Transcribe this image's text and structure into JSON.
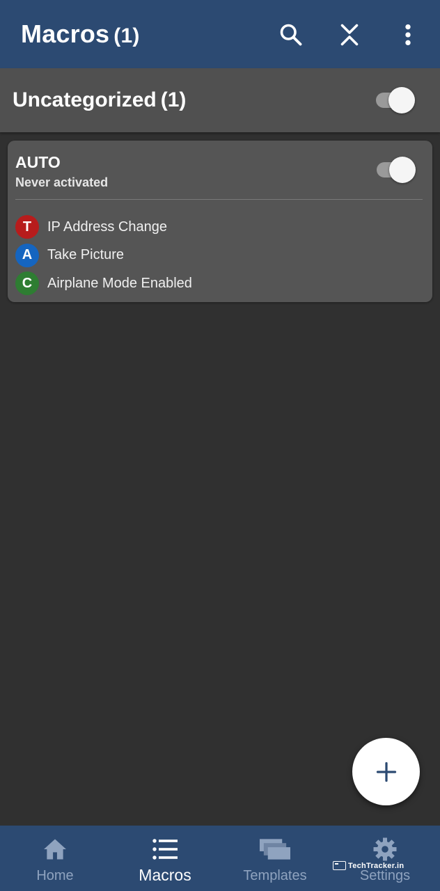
{
  "appbar": {
    "title": "Macros",
    "count": "(1)",
    "actions": [
      "search-icon",
      "collapse-expand-icon",
      "more-vert-icon"
    ]
  },
  "category": {
    "title": "Uncategorized",
    "count": "(1)",
    "enabled": true
  },
  "macro": {
    "name": "AUTO",
    "status": "Never activated",
    "enabled": true,
    "steps": [
      {
        "badge": "T",
        "label": "IP Address Change",
        "color": "#b71c1c"
      },
      {
        "badge": "A",
        "label": "Take Picture",
        "color": "#1565c0"
      },
      {
        "badge": "C",
        "label": "Airplane Mode Enabled",
        "color": "#2e7d32"
      }
    ]
  },
  "fab": {
    "icon": "plus-icon"
  },
  "bottom_nav": {
    "active": "Macros",
    "items": [
      {
        "label": "Home",
        "icon": "home-icon"
      },
      {
        "label": "Macros",
        "icon": "list-icon"
      },
      {
        "label": "Templates",
        "icon": "templates-icon"
      },
      {
        "label": "Settings",
        "icon": "gear-icon"
      }
    ]
  },
  "watermark": "TechTracker.in",
  "colors": {
    "appbar": "#2c4a72",
    "background": "#303030",
    "category": "#505050",
    "card": "#555555"
  }
}
